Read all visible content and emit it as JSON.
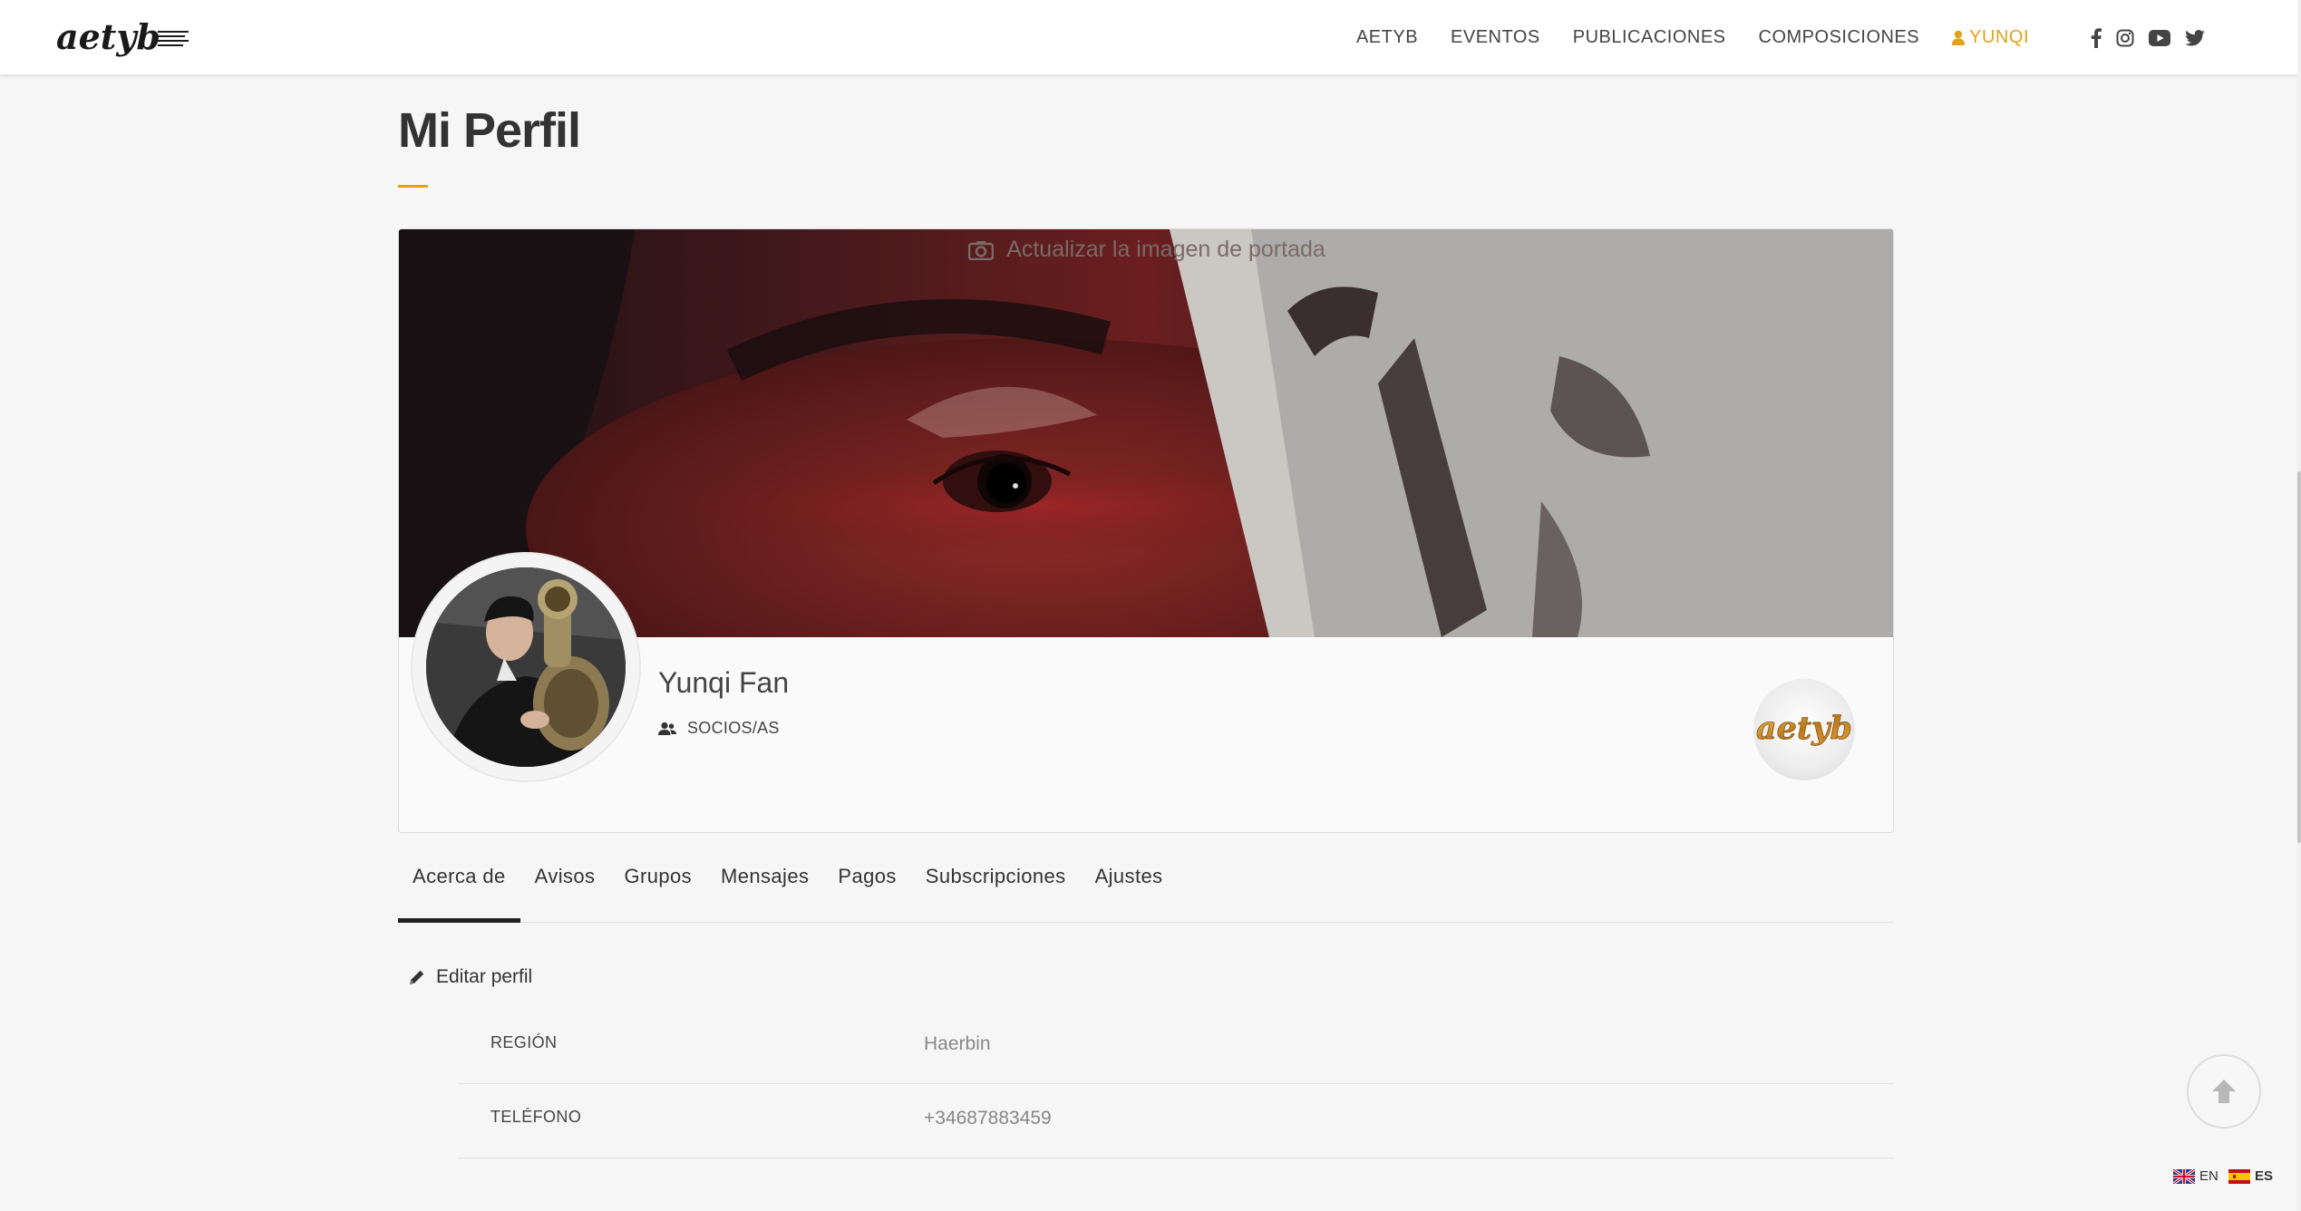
{
  "header": {
    "logo_text": "aetyb",
    "nav": [
      {
        "label": "AETYB"
      },
      {
        "label": "EVENTOS"
      },
      {
        "label": "PUBLICACIONES"
      },
      {
        "label": "COMPOSICIONES"
      }
    ],
    "user_menu_label": "YUNQI",
    "social": [
      "facebook-icon",
      "instagram-icon",
      "youtube-icon",
      "twitter-icon"
    ]
  },
  "page": {
    "title": "Mi Perfil"
  },
  "profile": {
    "cover_update_label": "Actualizar la imagen de portada",
    "name": "Yunqi Fan",
    "role": "SOCIOS/AS",
    "badge_text": "aetyb"
  },
  "tabs": [
    {
      "label": "Acerca de",
      "active": true
    },
    {
      "label": "Avisos"
    },
    {
      "label": "Grupos"
    },
    {
      "label": "Mensajes"
    },
    {
      "label": "Pagos"
    },
    {
      "label": "Subscripciones"
    },
    {
      "label": "Ajustes"
    }
  ],
  "about": {
    "edit_label": "Editar perfil",
    "fields": [
      {
        "label": "REGIÓN",
        "value": "Haerbin"
      },
      {
        "label": "TELÉFONO",
        "value": "+34687883459"
      }
    ]
  },
  "languages": [
    {
      "code": "EN"
    },
    {
      "code": "ES"
    }
  ],
  "colors": {
    "accent": "#e3a21a",
    "background": "#f6f6f6"
  }
}
